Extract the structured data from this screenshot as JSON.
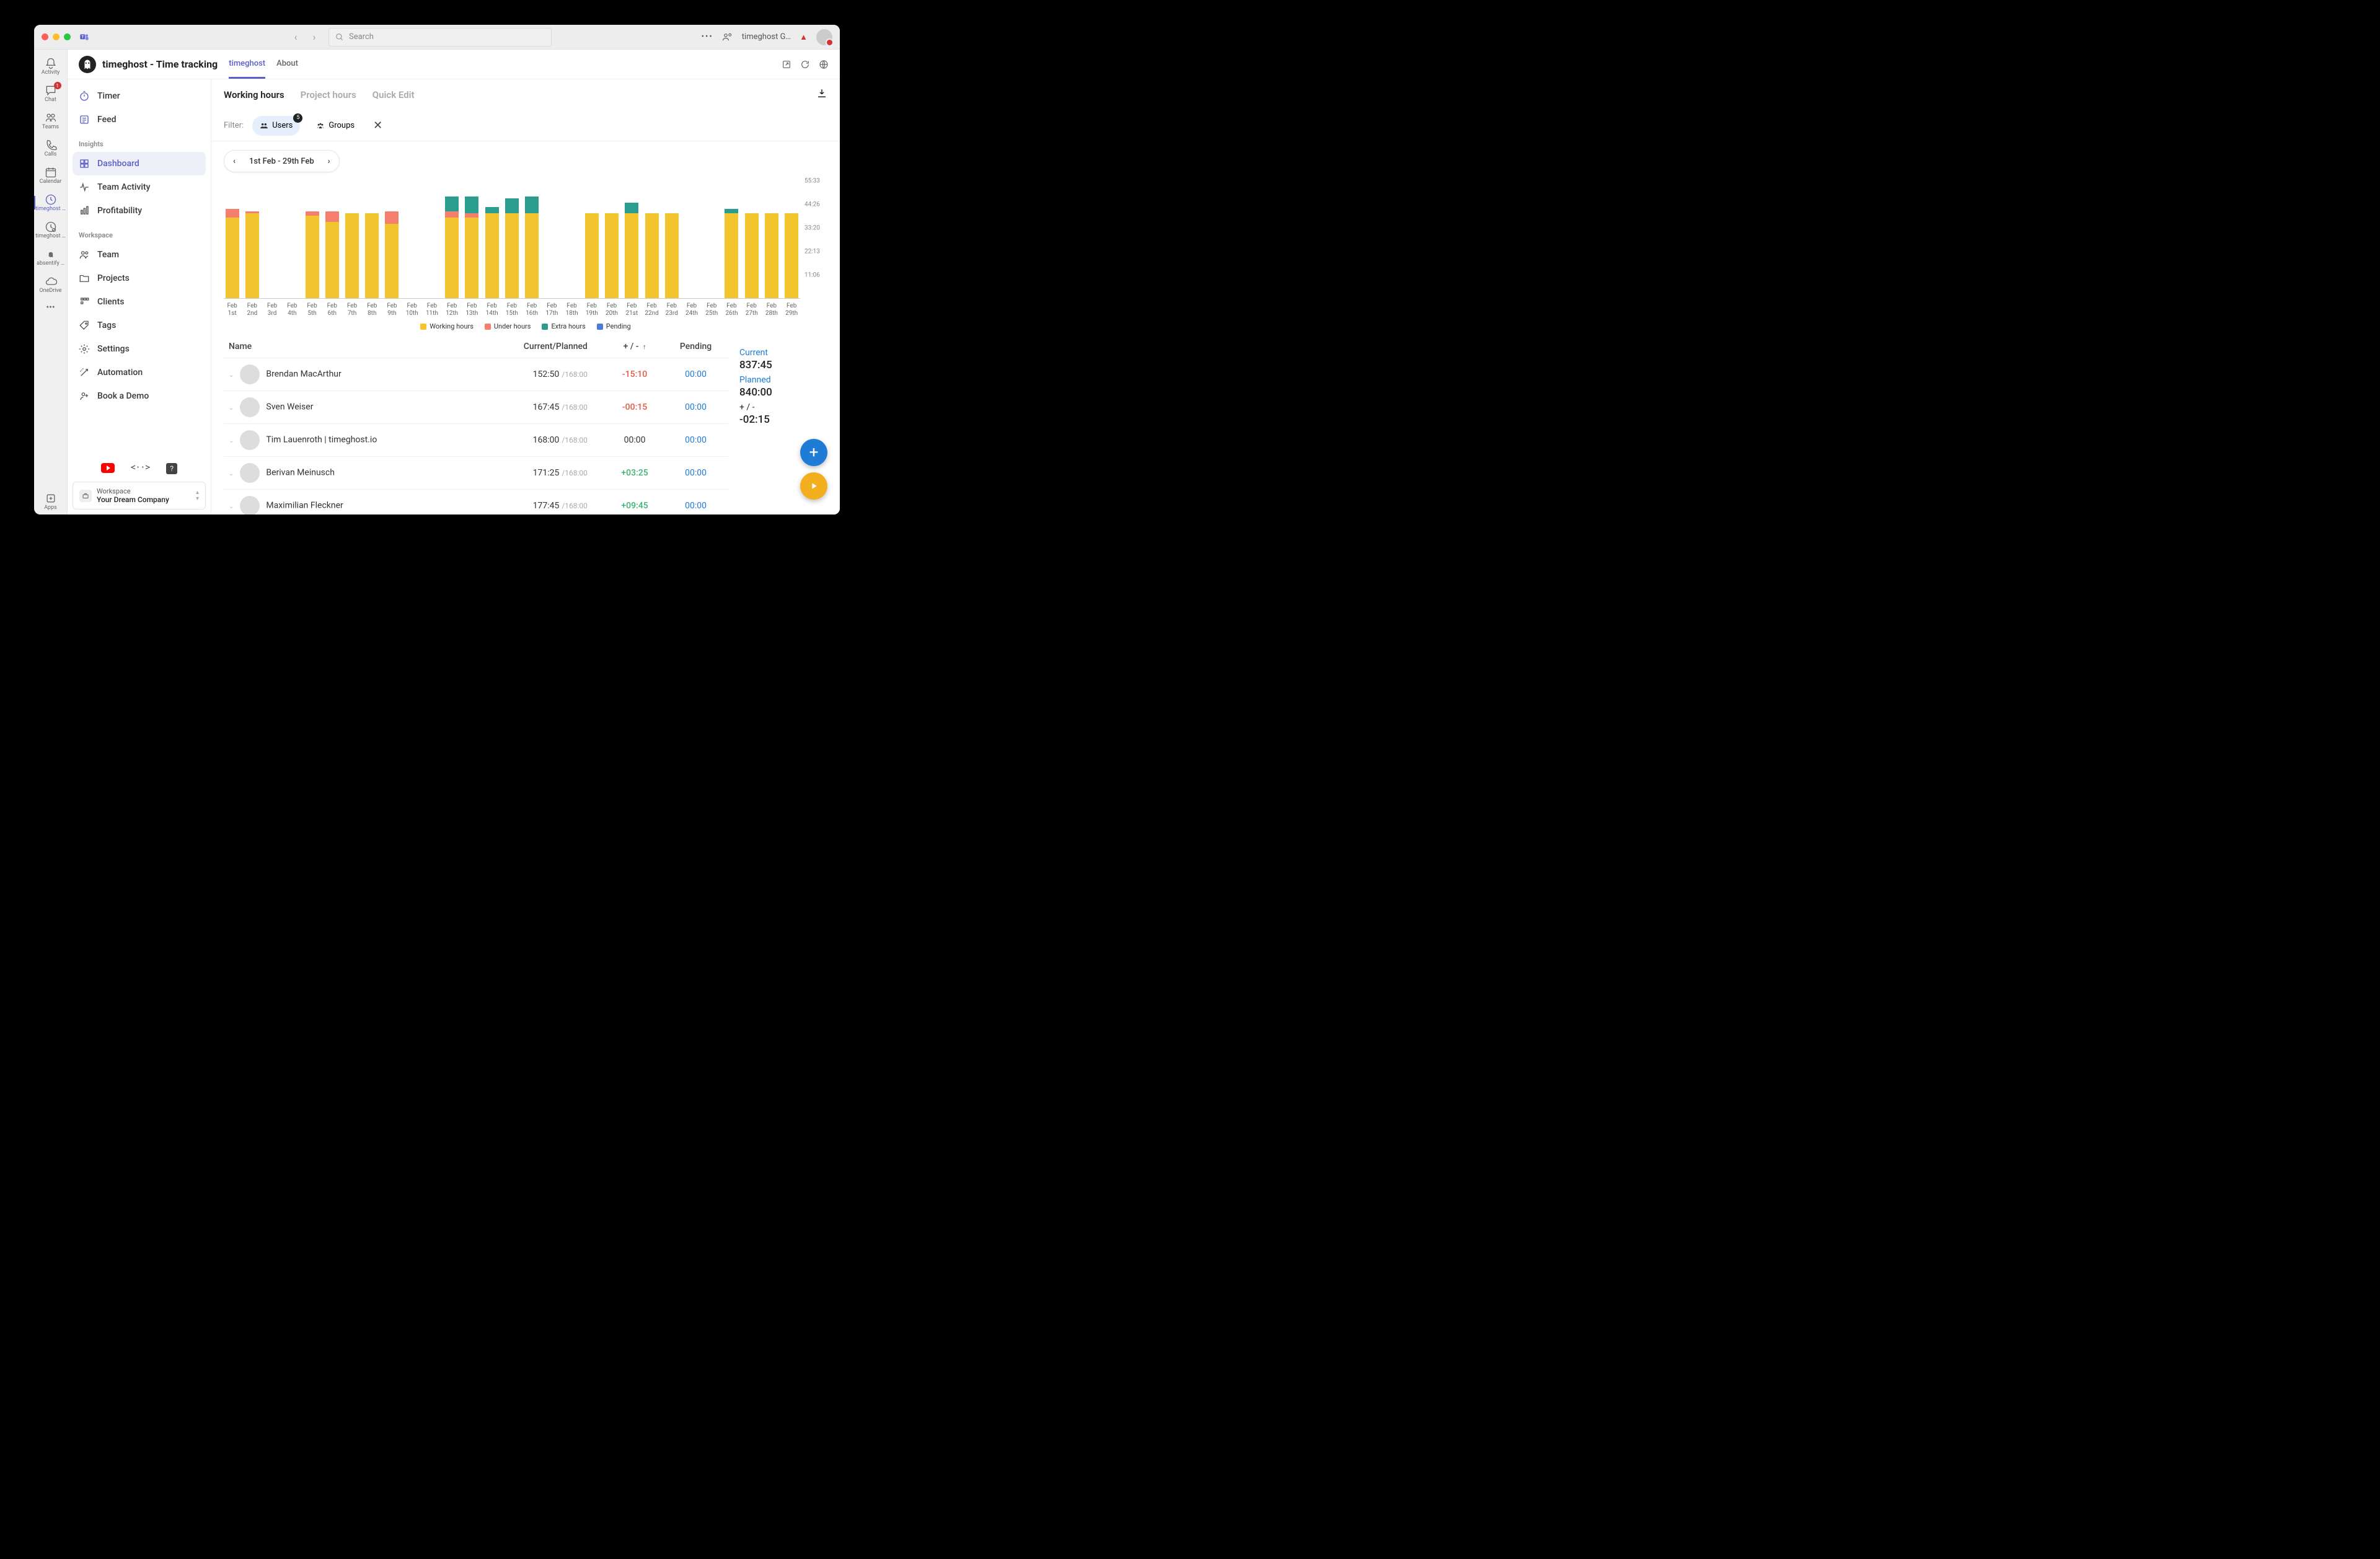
{
  "colors": {
    "working": "#f2c52f",
    "under": "#f57f6d",
    "extra": "#2a9d8f",
    "pending": "#4a7bd6"
  },
  "titlebar": {
    "search_placeholder": "Search",
    "username": "timeghost G…"
  },
  "rail": [
    {
      "label": "Activity",
      "icon": "bell",
      "badge": null,
      "active": false
    },
    {
      "label": "Chat",
      "icon": "chat",
      "badge": "1",
      "active": false
    },
    {
      "label": "Teams",
      "icon": "teams",
      "badge": null,
      "active": false
    },
    {
      "label": "Calls",
      "icon": "phone",
      "badge": null,
      "active": false
    },
    {
      "label": "Calendar",
      "icon": "calendar",
      "badge": null,
      "active": false
    },
    {
      "label": "timeghost …",
      "icon": "clock",
      "badge": null,
      "active": true
    },
    {
      "label": "timeghost …",
      "icon": "clock2",
      "badge": null,
      "active": false
    },
    {
      "label": "absentify …",
      "icon": "a",
      "badge": null,
      "active": false
    },
    {
      "label": "OneDrive",
      "icon": "cloud",
      "badge": null,
      "active": false
    }
  ],
  "rail_more": "…",
  "rail_apps": "Apps",
  "header": {
    "title": "timeghost - Time tracking",
    "tabs": [
      {
        "label": "timeghost",
        "sel": true
      },
      {
        "label": "About",
        "sel": false
      }
    ]
  },
  "leftnav": {
    "items": [
      {
        "label": "Timer",
        "icon": "timer",
        "sel": false
      },
      {
        "label": "Feed",
        "icon": "feed",
        "sel": false
      }
    ],
    "sections": [
      {
        "title": "Insights",
        "items": [
          {
            "label": "Dashboard",
            "icon": "grid",
            "sel": true
          },
          {
            "label": "Team Activity",
            "icon": "pulse",
            "sel": false
          },
          {
            "label": "Profitability",
            "icon": "bars",
            "sel": false
          }
        ]
      },
      {
        "title": "Workspace",
        "items": [
          {
            "label": "Team",
            "icon": "people",
            "sel": false
          },
          {
            "label": "Projects",
            "icon": "folder",
            "sel": false
          },
          {
            "label": "Clients",
            "icon": "briefcase",
            "sel": false
          },
          {
            "label": "Tags",
            "icon": "tag",
            "sel": false
          },
          {
            "label": "Settings",
            "icon": "gear",
            "sel": false
          },
          {
            "label": "Automation",
            "icon": "wand",
            "sel": false
          },
          {
            "label": "Book a Demo",
            "icon": "personadd",
            "sel": false
          }
        ]
      }
    ],
    "workspace_label": "Workspace",
    "workspace_name": "Your Dream Company"
  },
  "content_tabs": [
    {
      "label": "Working hours",
      "sel": true
    },
    {
      "label": "Project hours",
      "sel": false
    },
    {
      "label": "Quick Edit",
      "sel": false
    }
  ],
  "filter": {
    "label": "Filter:",
    "users": {
      "label": "Users",
      "badge": "5",
      "sel": true
    },
    "groups": {
      "label": "Groups",
      "sel": false
    }
  },
  "date_range": "1st Feb - 29th Feb",
  "chart_data": {
    "type": "bar",
    "ymax": 55.55,
    "yticks": [
      "55:33",
      "44:26",
      "33:20",
      "22:13",
      "11:06"
    ],
    "legend": [
      "Working hours",
      "Under hours",
      "Extra hours",
      "Pending"
    ],
    "categories": [
      "Feb 1st",
      "Feb 2nd",
      "Feb 3rd",
      "Feb 4th",
      "Feb 5th",
      "Feb 6th",
      "Feb 7th",
      "Feb 8th",
      "Feb 9th",
      "Feb 10th",
      "Feb 11th",
      "Feb 12th",
      "Feb 13th",
      "Feb 14th",
      "Feb 15th",
      "Feb 16th",
      "Feb 17th",
      "Feb 18th",
      "Feb 19th",
      "Feb 20th",
      "Feb 21st",
      "Feb 22nd",
      "Feb 23rd",
      "Feb 24th",
      "Feb 25th",
      "Feb 26th",
      "Feb 27th",
      "Feb 28th",
      "Feb 29th"
    ],
    "days": [
      {
        "working": 38,
        "under": 4,
        "extra": 0
      },
      {
        "working": 40,
        "under": 1,
        "extra": 0
      },
      {
        "working": 0,
        "under": 0,
        "extra": 0
      },
      {
        "working": 0,
        "under": 0,
        "extra": 0
      },
      {
        "working": 39,
        "under": 2,
        "extra": 0
      },
      {
        "working": 36,
        "under": 5,
        "extra": 0
      },
      {
        "working": 40,
        "under": 0,
        "extra": 0
      },
      {
        "working": 40,
        "under": 0,
        "extra": 0
      },
      {
        "working": 35,
        "under": 6,
        "extra": 0
      },
      {
        "working": 0,
        "under": 0,
        "extra": 0
      },
      {
        "working": 0,
        "under": 0,
        "extra": 0
      },
      {
        "working": 38,
        "under": 3,
        "extra": 7
      },
      {
        "working": 38,
        "under": 2,
        "extra": 8
      },
      {
        "working": 40,
        "under": 0,
        "extra": 3
      },
      {
        "working": 40,
        "under": 0,
        "extra": 7
      },
      {
        "working": 40,
        "under": 0,
        "extra": 8
      },
      {
        "working": 0,
        "under": 0,
        "extra": 0
      },
      {
        "working": 0,
        "under": 0,
        "extra": 0
      },
      {
        "working": 40,
        "under": 0,
        "extra": 0
      },
      {
        "working": 40,
        "under": 0,
        "extra": 0
      },
      {
        "working": 40,
        "under": 0,
        "extra": 5
      },
      {
        "working": 40,
        "under": 0,
        "extra": 0
      },
      {
        "working": 40,
        "under": 0,
        "extra": 0
      },
      {
        "working": 0,
        "under": 0,
        "extra": 0
      },
      {
        "working": 0,
        "under": 0,
        "extra": 0
      },
      {
        "working": 40,
        "under": 0,
        "extra": 2
      },
      {
        "working": 40,
        "under": 0,
        "extra": 0
      },
      {
        "working": 40,
        "under": 0,
        "extra": 0
      },
      {
        "working": 40,
        "under": 0,
        "extra": 0
      }
    ]
  },
  "table": {
    "headers": {
      "name": "Name",
      "cp": "Current/Planned",
      "delta": "+ / -",
      "pending": "Pending"
    },
    "sort_indicator": "↑",
    "rows": [
      {
        "name": "Brendan MacArthur",
        "current": "152:50",
        "planned": "/168:00",
        "delta": "-15:10",
        "delta_cls": "neg",
        "pending": "00:00"
      },
      {
        "name": "Sven Weiser",
        "current": "167:45",
        "planned": "/168:00",
        "delta": "-00:15",
        "delta_cls": "neg",
        "pending": "00:00"
      },
      {
        "name": "Tim Lauenroth | timeghost.io",
        "current": "168:00",
        "planned": "/168:00",
        "delta": "00:00",
        "delta_cls": "zero",
        "pending": "00:00"
      },
      {
        "name": "Berivan Meinusch",
        "current": "171:25",
        "planned": "/168:00",
        "delta": "+03:25",
        "delta_cls": "pos",
        "pending": "00:00"
      },
      {
        "name": "Maximilian Fleckner",
        "current": "177:45",
        "planned": "/168:00",
        "delta": "+09:45",
        "delta_cls": "pos",
        "pending": "00:00"
      }
    ]
  },
  "summary": {
    "current_label": "Current",
    "current_val": "837:45",
    "planned_label": "Planned",
    "planned_val": "840:00",
    "delta_label": "+ / -",
    "delta_val": "-02:15"
  }
}
